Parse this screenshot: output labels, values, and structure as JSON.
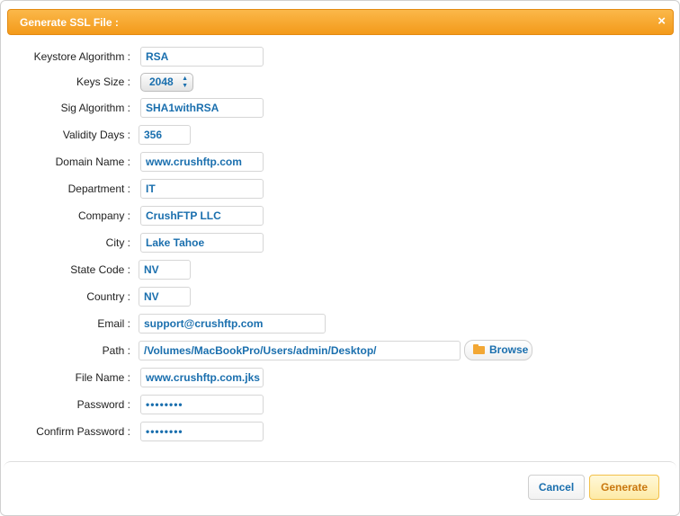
{
  "dialog": {
    "title": "Generate SSL File :",
    "close_label": "×"
  },
  "form": {
    "keystore_algorithm": {
      "label": "Keystore Algorithm :",
      "value": "RSA"
    },
    "keys_size": {
      "label": "Keys Size :",
      "value": "2048",
      "arrows": "▲▼"
    },
    "sig_algorithm": {
      "label": "Sig Algorithm :",
      "value": "SHA1withRSA"
    },
    "validity_days": {
      "label": "Validity Days :",
      "value": "356"
    },
    "domain_name": {
      "label": "Domain Name :",
      "value": "www.crushftp.com"
    },
    "department": {
      "label": "Department :",
      "value": "IT"
    },
    "company": {
      "label": "Company :",
      "value": "CrushFTP LLC"
    },
    "city": {
      "label": "City :",
      "value": "Lake Tahoe"
    },
    "state_code": {
      "label": "State Code :",
      "value": "NV"
    },
    "country": {
      "label": "Country :",
      "value": "NV"
    },
    "email": {
      "label": "Email :",
      "value": "support@crushftp.com"
    },
    "path": {
      "label": "Path :",
      "value": "/Volumes/MacBookPro/Users/admin/Desktop/",
      "browse_label": "Browse"
    },
    "file_name": {
      "label": "File Name :",
      "value": "www.crushftp.com.jks"
    },
    "password": {
      "label": "Password :",
      "value": "••••••••"
    },
    "confirm_password": {
      "label": "Confirm Password :",
      "value": "••••••••"
    }
  },
  "footer": {
    "cancel_label": "Cancel",
    "generate_label": "Generate"
  },
  "icons": {
    "close": "close-icon",
    "browse": "folder-icon",
    "select_arrows": "up-down-arrows-icon"
  },
  "colors": {
    "titlebar": "#f5a623",
    "value_text": "#1a6fae",
    "generate_text": "#c9770f"
  }
}
